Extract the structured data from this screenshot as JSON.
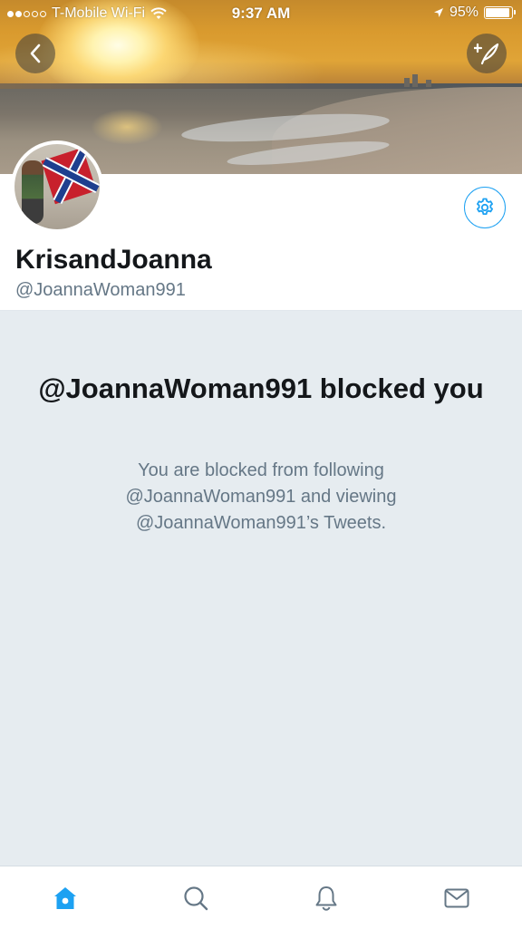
{
  "status_bar": {
    "carrier": "T-Mobile Wi-Fi",
    "signal_dots_filled": 2,
    "signal_dots_total": 5,
    "time": "9:37 AM",
    "battery": "95%",
    "battery_level": 0.95
  },
  "header": {
    "back_icon": "chevron-left-icon",
    "compose_icon": "compose-tweet-icon"
  },
  "profile": {
    "display_name": "KrisandJoanna",
    "handle": "@JoannaWoman991",
    "settings_icon": "gear-icon"
  },
  "blocked": {
    "title": "@JoannaWoman991 blocked you",
    "description": "You are blocked from following @JoannaWoman991 and viewing @JoannaWoman991’s Tweets."
  },
  "tabs": [
    {
      "name": "home",
      "icon": "home-icon",
      "active": true
    },
    {
      "name": "search",
      "icon": "search-icon",
      "active": false
    },
    {
      "name": "notifications",
      "icon": "bell-icon",
      "active": false
    },
    {
      "name": "messages",
      "icon": "envelope-icon",
      "active": false
    }
  ],
  "colors": {
    "accent": "#1da1f2",
    "inactive_icon": "#657786",
    "background": "#e6ecf0"
  }
}
